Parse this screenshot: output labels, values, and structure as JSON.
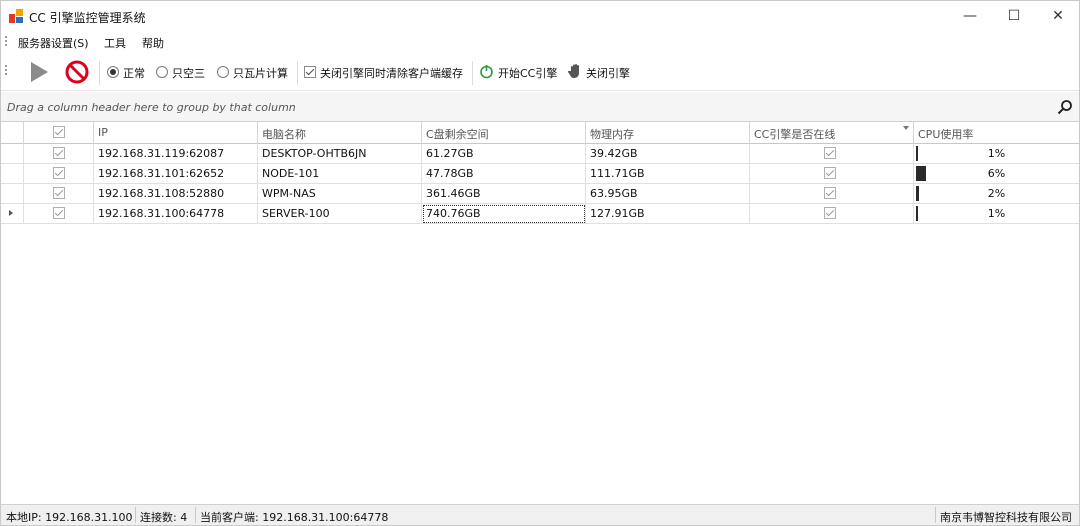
{
  "window": {
    "title": "CC 引擎监控管理系统",
    "minimize_glyph": "—",
    "maximize_glyph": "☐",
    "close_glyph": "✕"
  },
  "menu": {
    "items": [
      "服务器设置(S)",
      "工具",
      "帮助"
    ]
  },
  "toolbar": {
    "play_icon": "play-icon",
    "stop_icon": "stop-icon",
    "modes": [
      "正常",
      "只空三",
      "只瓦片计算"
    ],
    "selected_mode": "正常",
    "clear_cache_label": "关闭引擎同时清除客户端缓存",
    "clear_cache_checked": true,
    "start_label": "开始CC引擎",
    "stop_label": "关闭引擎"
  },
  "group_panel": {
    "hint": "Drag a column header here to group by that column"
  },
  "grid": {
    "columns": [
      "IP",
      "电脑名称",
      "C盘剩余空间",
      "物理内存",
      "CC引擎是否在线",
      "CPU使用率"
    ],
    "rows": [
      {
        "selected": true,
        "ip": "192.168.31.119:62087",
        "name": "DESKTOP-OHTB6JN",
        "c_free": "61.27GB",
        "memory": "39.42GB",
        "online": true,
        "cpu": "1%",
        "cpu_value": 1
      },
      {
        "selected": true,
        "ip": "192.168.31.101:62652",
        "name": "NODE-101",
        "c_free": "47.78GB",
        "memory": "111.71GB",
        "online": true,
        "cpu": "6%",
        "cpu_value": 6
      },
      {
        "selected": true,
        "ip": "192.168.31.108:52880",
        "name": "WPM-NAS",
        "c_free": "361.46GB",
        "memory": "63.95GB",
        "online": true,
        "cpu": "2%",
        "cpu_value": 2
      },
      {
        "selected": true,
        "ip": "192.168.31.100:64778",
        "name": "SERVER-100",
        "c_free": "740.76GB",
        "memory": "127.91GB",
        "online": true,
        "cpu": "1%",
        "cpu_value": 1
      }
    ],
    "current_row": 3
  },
  "status": {
    "local_ip": "本地IP: 192.168.31.100",
    "connections": "连接数: 4",
    "current_client": "当前客户端: 192.168.31.100:64778",
    "company": "南京韦博智控科技有限公司"
  },
  "colors": {
    "stop_red": "#e0001b",
    "play_gray": "#8a8a8a",
    "start_green": "#2e9b3a"
  }
}
